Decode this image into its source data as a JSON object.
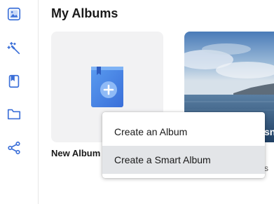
{
  "page": {
    "title": "My Albums"
  },
  "sidebar": {
    "items": [
      {
        "icon": "photos-icon",
        "color": "#3b6fd8"
      },
      {
        "icon": "magic-wand-icon",
        "color": "#3b6fd8"
      },
      {
        "icon": "album-book-icon",
        "color": "#3b6fd8"
      },
      {
        "icon": "folder-icon",
        "color": "#3b6fd8"
      },
      {
        "icon": "share-icon",
        "color": "#3b6fd8"
      }
    ]
  },
  "albums": {
    "new_album": {
      "label": "New Album",
      "icon": "new-album-book-icon"
    },
    "photo_album": {
      "title_fragment": "sn",
      "subtitle_fragment": "s"
    }
  },
  "context_menu": {
    "items": [
      {
        "label": "Create an Album"
      },
      {
        "label": "Create a Smart Album",
        "highlighted": true
      }
    ]
  },
  "colors": {
    "accent": "#3b6fd8",
    "menu_highlight": "#e3e5e8",
    "card_background": "#f2f2f3"
  }
}
